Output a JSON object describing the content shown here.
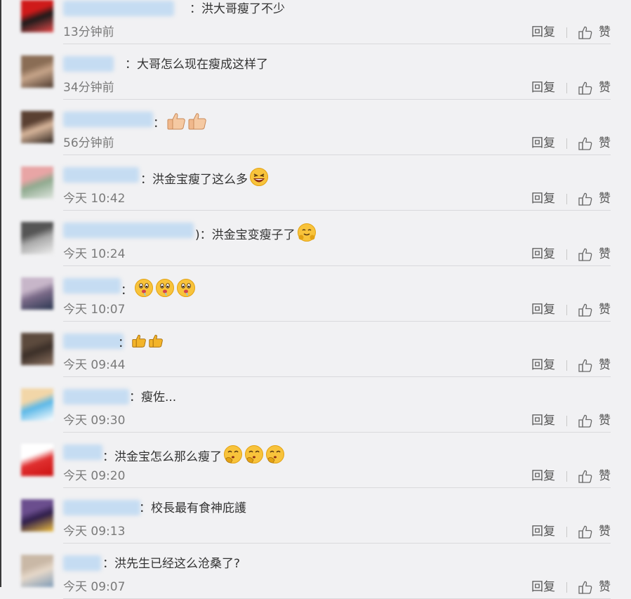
{
  "colors": {
    "background": "#f1f1f3",
    "divider": "#d9d9dc",
    "text": "#333333",
    "muted": "#7a7a7a",
    "username_blur": "#c5dcf2"
  },
  "actions": {
    "reply": "回复",
    "like": "赞"
  },
  "comments": [
    {
      "username_hidden": true,
      "text": "：洪大哥瘦了不少",
      "emojis": [],
      "time": "13分钟前",
      "avatar_colors": [
        "#cf1a1a",
        "#1a1a1a",
        "#e84b4b"
      ]
    },
    {
      "username_hidden": true,
      "text": "：大哥怎么现在瘦成这样了",
      "emojis": [],
      "time": "34分钟前",
      "avatar_colors": [
        "#8a6d55",
        "#c7a58a",
        "#4d3a2e"
      ]
    },
    {
      "username_hidden": true,
      "text": "：",
      "emojis": [
        "thumbs-up-icon",
        "thumbs-up-icon"
      ],
      "time": "56分钟前",
      "avatar_colors": [
        "#5a4032",
        "#d8b69b",
        "#2e241e"
      ]
    },
    {
      "username_hidden": true,
      "text": "：洪金宝瘦了这么多",
      "emojis": [
        "laughing-face-icon"
      ],
      "time": "今天 10:42",
      "avatar_colors": [
        "#e8a5a5",
        "#8faa8f",
        "#dfe6df"
      ]
    },
    {
      "username_hidden": true,
      "text": ")：洪金宝变瘦子了",
      "emojis": [
        "hugging-face-icon"
      ],
      "time": "今天 10:24",
      "avatar_colors": [
        "#555555",
        "#aaaaaa",
        "#eeeeee"
      ]
    },
    {
      "username_hidden": true,
      "text": "：",
      "emojis": [
        "drooling-face-icon",
        "drooling-face-icon",
        "drooling-face-icon"
      ],
      "time": "今天 10:07",
      "avatar_colors": [
        "#c7b6c9",
        "#7a6a88",
        "#2a3650"
      ]
    },
    {
      "username_hidden": true,
      "text": "：",
      "emojis": [
        "thumbs-up-icon-small",
        "thumbs-up-icon-small"
      ],
      "time": "今天 09:44",
      "avatar_colors": [
        "#5c4a3d",
        "#3b2f28",
        "#8c7260"
      ]
    },
    {
      "username_hidden": true,
      "text": "：瘦佐...",
      "emojis": [],
      "time": "今天 09:30",
      "avatar_colors": [
        "#f2d6a8",
        "#5bb8e8",
        "#ffffff"
      ]
    },
    {
      "username_hidden": true,
      "text": "：洪金宝怎么那么瘦了",
      "emojis": [
        "shushing-face-icon",
        "shushing-face-icon",
        "shushing-face-icon"
      ],
      "time": "今天 09:20",
      "avatar_colors": [
        "#ffffff",
        "#e03030",
        "#cc1111"
      ]
    },
    {
      "username_hidden": true,
      "text": "：校長最有食神庇護",
      "emojis": [],
      "time": "今天 09:13",
      "avatar_colors": [
        "#6b4e8e",
        "#2e1d4a",
        "#f0c040"
      ]
    },
    {
      "username_hidden": true,
      "text": "：洪先生已经这么沧桑了?",
      "emojis": [],
      "time": "今天 09:07",
      "avatar_colors": [
        "#c9b8a6",
        "#e6d8c9",
        "#7e9bb7"
      ]
    }
  ]
}
